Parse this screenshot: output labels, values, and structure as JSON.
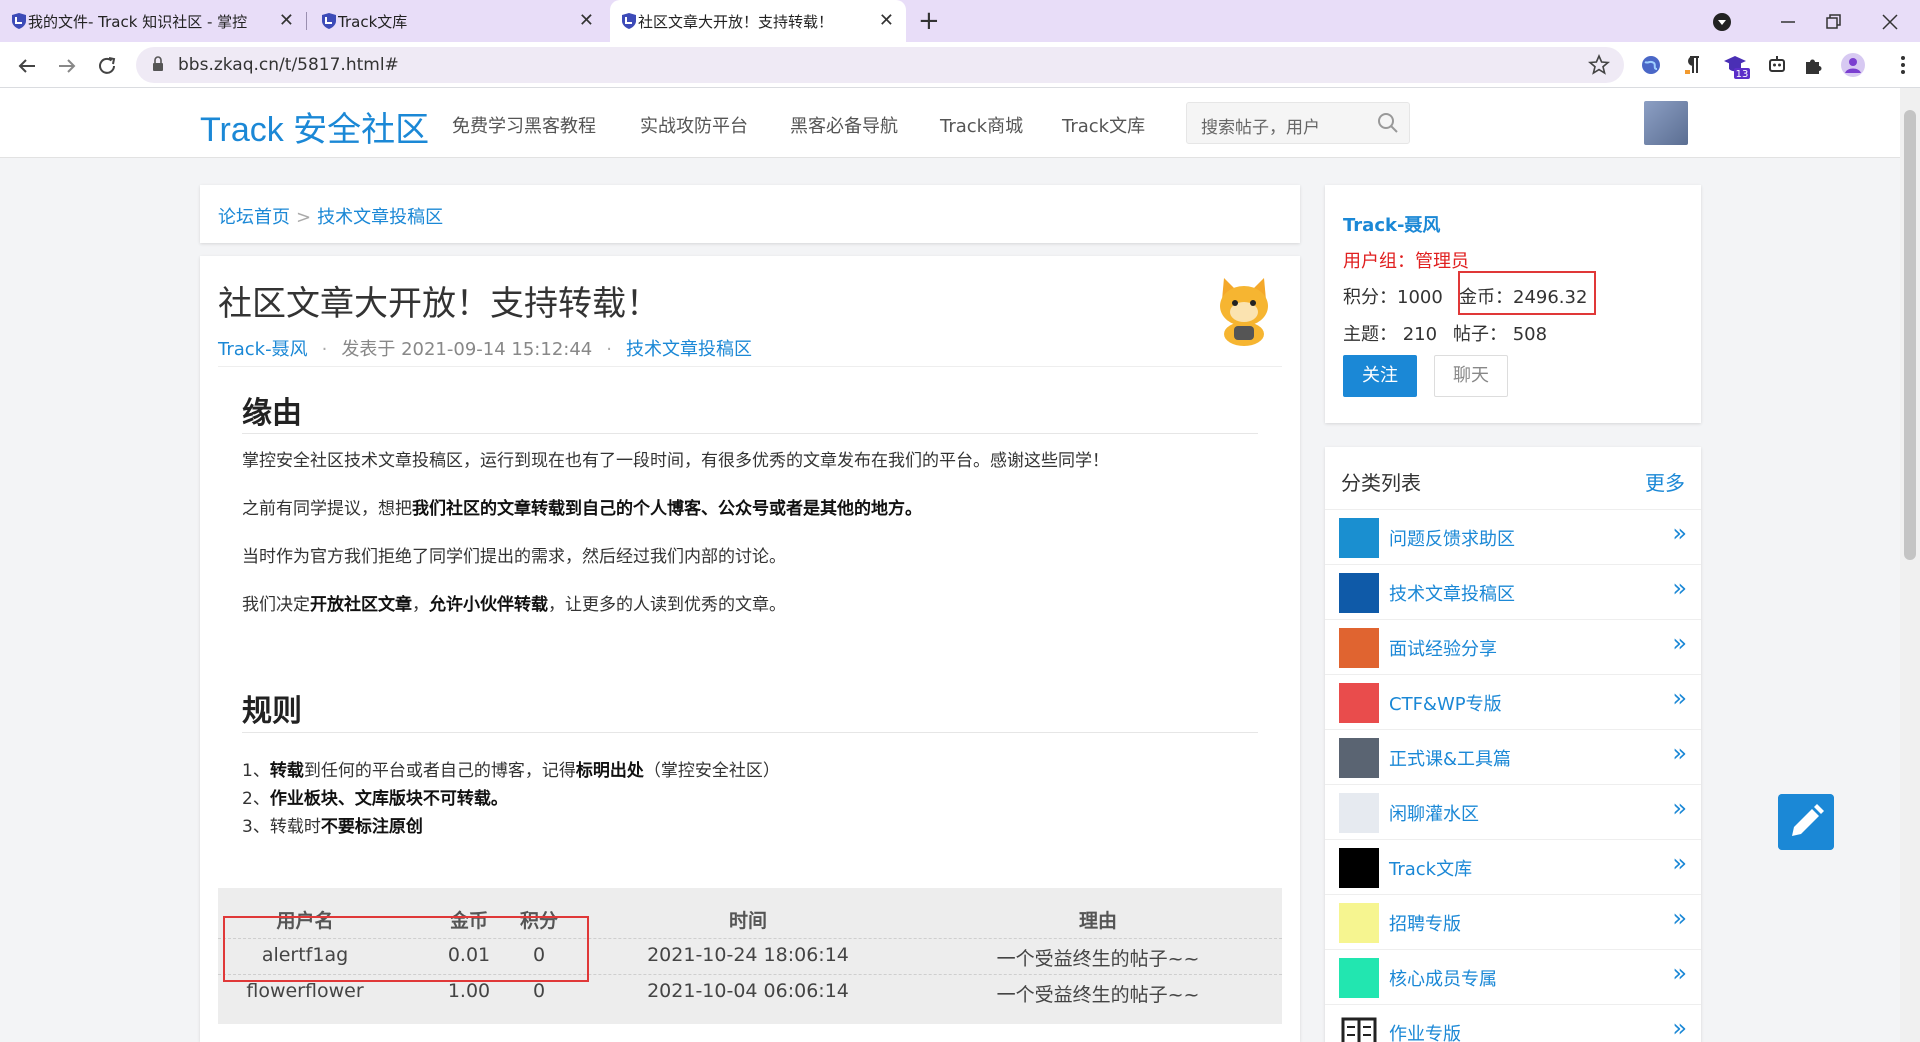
{
  "browser": {
    "tabs": [
      {
        "label": "我的文件- Track 知识社区 - 掌控",
        "close": "✕"
      },
      {
        "label": "Track文库",
        "close": "✕"
      },
      {
        "label": "社区文章大开放！支持转载！",
        "close": "✕"
      }
    ],
    "new_tab": "+",
    "url": "bbs.zkaq.cn/t/5817.html#",
    "extension_badge": "13"
  },
  "site": {
    "logo": "Track 安全社区",
    "nav": [
      "免费学习黑客教程",
      "实战攻防平台",
      "黑客必备导航",
      "Track商城",
      "Track文库"
    ],
    "search_placeholder": "搜索帖子，用户"
  },
  "breadcrumb": {
    "home": "论坛首页",
    "sep": ">",
    "section": "技术文章投稿区"
  },
  "article": {
    "title": "社区文章大开放！支持转载！",
    "author": "Track-聂风",
    "posted": "发表于 2021-09-14 15:12:44",
    "section": "技术文章投稿区",
    "sec1_title": "缘由",
    "p1": "掌控安全社区技术文章投稿区，运行到现在也有了一段时间，有很多优秀的文章发布在我们的平台。感谢这些同学！",
    "p2_a": "之前有同学提议，想把",
    "p2_b": "我们社区的文章转载到自己的个人博客、公众号或者是其他的地方。",
    "p3": "当时作为官方我们拒绝了同学们提出的需求，然后经过我们内部的讨论。",
    "p4_a": "我们决定",
    "p4_b": "开放社区文章",
    "p4_c": "，",
    "p4_d": "允许小伙伴转载",
    "p4_e": "，让更多的人读到优秀的文章。",
    "sec2_title": "规则",
    "r1_a": "1、",
    "r1_b": "转载",
    "r1_c": "到任何的平台或者自己的博客，记得",
    "r1_d": "标明出处",
    "r1_e": "（掌控安全社区）",
    "r2_a": "2、",
    "r2_b": "作业板块、文库版块不可转载。",
    "r3_a": "3、转载时",
    "r3_b": "不要标注原创"
  },
  "rewards": {
    "headers": {
      "user": "用户名",
      "coins": "金币",
      "points": "积分",
      "time": "时间",
      "reason": "理由"
    },
    "rows": [
      {
        "user": "alertf1ag",
        "coins": "0.01",
        "points": "0",
        "time": "2021-10-24 18:06:14",
        "reason": "一个受益终生的帖子~~"
      },
      {
        "user": "flowerflower",
        "coins": "1.00",
        "points": "0",
        "time": "2021-10-04 06:06:14",
        "reason": "一个受益终生的帖子~~"
      }
    ]
  },
  "user": {
    "name": "Track-聂风",
    "group": "用户组：管理员",
    "points": "积分：1000",
    "coins": "金币：2496.32",
    "topics": "主题：  210",
    "posts": "帖子：  508",
    "follow": "关注",
    "chat": "聊天"
  },
  "categories": {
    "title": "分类列表",
    "more": "更多",
    "items": [
      {
        "label": "问题反馈求助区",
        "color": "#1a8fd0"
      },
      {
        "label": "技术文章投稿区",
        "color": "#0f5aa8"
      },
      {
        "label": "面试经验分享",
        "color": "#e06430"
      },
      {
        "label": "CTF&WP专版",
        "color": "#e94c4c"
      },
      {
        "label": "正式课&工具篇",
        "color": "#5a6472"
      },
      {
        "label": "闲聊灌水区",
        "color": "#e6eaf0"
      },
      {
        "label": "Track文库",
        "color": "#000000"
      },
      {
        "label": "招聘专版",
        "color": "#f6f590"
      },
      {
        "label": "核心成员专属",
        "color": "#22e6b0"
      },
      {
        "label": "作业专版",
        "color": "#ffffff"
      }
    ],
    "arrow": "»"
  }
}
